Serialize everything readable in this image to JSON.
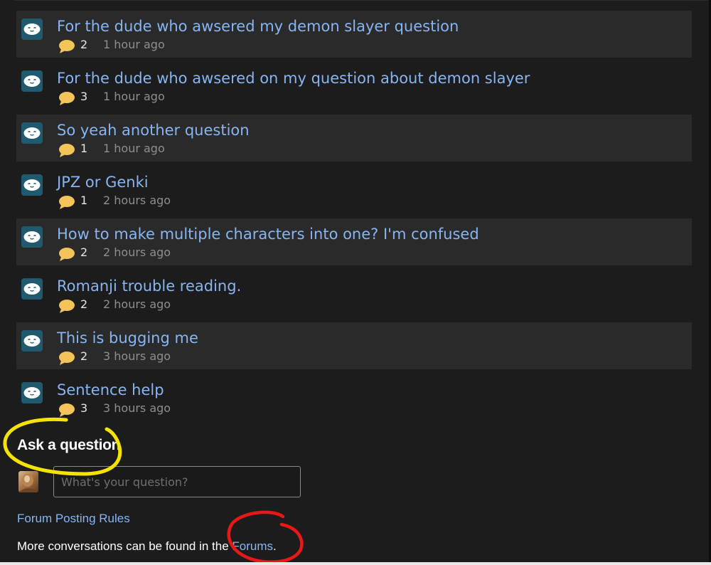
{
  "threads": [
    {
      "title": "For the dude who awsered my demon slayer question",
      "replies": "2",
      "time": "1 hour ago"
    },
    {
      "title": "For the dude who awsered on my question about demon slayer",
      "replies": "3",
      "time": "1 hour ago"
    },
    {
      "title": "So yeah another question",
      "replies": "1",
      "time": "1 hour ago"
    },
    {
      "title": "JPZ or Genki",
      "replies": "1",
      "time": "2 hours ago"
    },
    {
      "title": "How to make multiple characters into one? I'm confused",
      "replies": "2",
      "time": "2 hours ago"
    },
    {
      "title": "Romanji trouble reading.",
      "replies": "2",
      "time": "2 hours ago"
    },
    {
      "title": "This is bugging me",
      "replies": "2",
      "time": "3 hours ago"
    },
    {
      "title": "Sentence help",
      "replies": "3",
      "time": "3 hours ago"
    }
  ],
  "ask": {
    "heading": "Ask a question",
    "placeholder": "What's your question?"
  },
  "footer": {
    "rules_label": "Forum Posting Rules",
    "more_text": "More conversations can be found in the ",
    "forums_label": "Forums",
    "period": "."
  },
  "colors": {
    "background": "#1c1c1c",
    "row_alt": "#2a2a2a",
    "link": "#87b5f2",
    "icon_teal": "#1f5a6e",
    "bubble": "#f2c45a",
    "highlight_yellow": "#f5e400",
    "highlight_red": "#e81818"
  },
  "icons": {
    "thread_avatar": "forum-user-face-icon",
    "reply": "speech-bubble-icon"
  }
}
